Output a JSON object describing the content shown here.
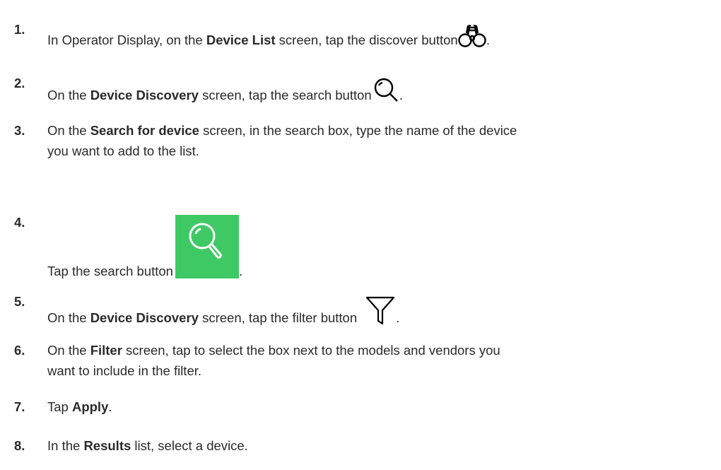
{
  "steps": [
    {
      "number": "1.",
      "parts": [
        "In Operator Display, on the ",
        "Device List",
        " screen, tap the discover button ",
        "."
      ],
      "icon": "binoculars-icon"
    },
    {
      "number": "2.",
      "parts": [
        "On the ",
        "Device Discovery",
        " screen, tap the search button ",
        "."
      ],
      "icon": "search-icon"
    },
    {
      "number": "3.",
      "parts": [
        "On the ",
        "Search for device",
        " screen, in the search box, type the name of the device",
        "you want to add to the list."
      ]
    },
    {
      "number": "4.",
      "parts": [
        "Tap the search button ",
        "."
      ],
      "icon": "green-search-icon",
      "icon_color": "#3ec964"
    },
    {
      "number": "5.",
      "parts": [
        "On the ",
        "Device Discovery",
        " screen, tap the filter button ",
        "."
      ],
      "icon": "filter-icon"
    },
    {
      "number": "6.",
      "parts": [
        "On the ",
        "Filter",
        " screen, tap to select the box next to the models and vendors you",
        "want to include in the filter."
      ]
    },
    {
      "number": "7.",
      "parts": [
        "Tap ",
        "Apply",
        "."
      ]
    },
    {
      "number": "8.",
      "parts": [
        "In the ",
        "Results",
        " list, select a device."
      ]
    }
  ]
}
